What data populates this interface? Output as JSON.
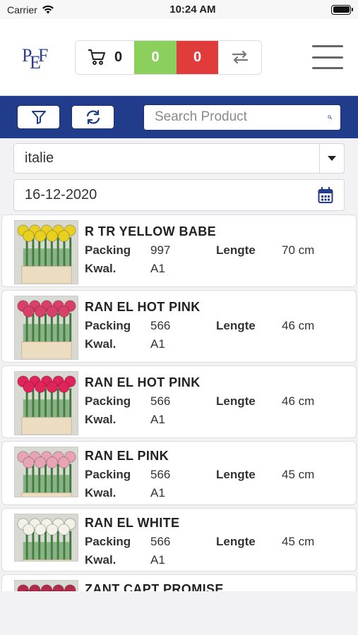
{
  "status_bar": {
    "carrier": "Carrier",
    "time": "10:24 AM"
  },
  "header": {
    "cart_count": "0",
    "green_count": "0",
    "red_count": "0"
  },
  "search": {
    "placeholder": "Search Product"
  },
  "filters": {
    "country": "italie",
    "date": "16-12-2020"
  },
  "labels": {
    "packing": "Packing",
    "length": "Lengte",
    "quality": "Kwal."
  },
  "products": [
    {
      "name": "R TR YELLOW BABE",
      "packing": "997",
      "length": "70 cm",
      "quality": "A1",
      "flower_color": "#e8d020"
    },
    {
      "name": "RAN EL HOT PINK",
      "packing": "566",
      "length": "46 cm",
      "quality": "A1",
      "flower_color": "#d8406a"
    },
    {
      "name": "RAN EL HOT PINK",
      "packing": "566",
      "length": "46 cm",
      "quality": "A1",
      "flower_color": "#e0245a"
    },
    {
      "name": "RAN EL PINK",
      "packing": "566",
      "length": "45 cm",
      "quality": "A1",
      "flower_color": "#e8a4b4"
    },
    {
      "name": "RAN EL WHITE",
      "packing": "566",
      "length": "45 cm",
      "quality": "A1",
      "flower_color": "#f2f2e8"
    },
    {
      "name": "ZANT CAPT PROMISE",
      "packing": "",
      "length": "",
      "quality": "",
      "flower_color": "#b02a4a"
    }
  ],
  "colors": {
    "brand_blue": "#213c8a",
    "green": "#8bcf5c",
    "red": "#e03c3c"
  }
}
